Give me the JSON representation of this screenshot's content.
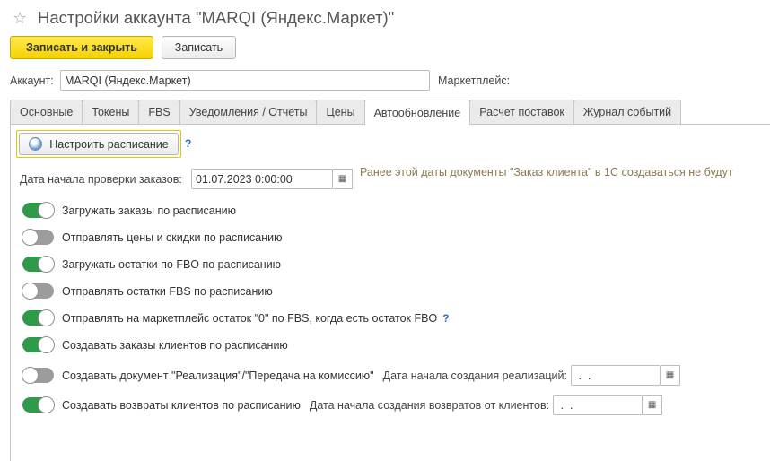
{
  "window": {
    "title": "Настройки аккаунта \"MARQI (Яндекс.Маркет)\"",
    "star_icon": "star-icon"
  },
  "toolbar": {
    "save_close_label": "Записать и закрыть",
    "save_label": "Записать"
  },
  "account": {
    "label": "Аккаунт:",
    "value": "MARQI (Яндекс.Маркет)",
    "marketplace_label": "Маркетплейс:"
  },
  "tabs": [
    {
      "label": "Основные"
    },
    {
      "label": "Токены"
    },
    {
      "label": "FBS"
    },
    {
      "label": "Уведомления / Отчеты"
    },
    {
      "label": "Цены"
    },
    {
      "label": "Автообновление",
      "active": true
    },
    {
      "label": "Расчет поставок"
    },
    {
      "label": "Журнал событий"
    }
  ],
  "schedule": {
    "button_label": "Настроить расписание",
    "help": "?"
  },
  "orders_check": {
    "label": "Дата начала проверки заказов:",
    "value": "01.07.2023  0:00:00",
    "note": "Ранее этой даты документы \"Заказ клиента\" в 1С создаваться не будут"
  },
  "toggles": [
    {
      "label": "Загружать заказы по расписанию",
      "on": true
    },
    {
      "label": "Отправлять цены и скидки по расписанию",
      "on": false
    },
    {
      "label": "Загружать остатки по FBO по расписанию",
      "on": true
    },
    {
      "label": "Отправлять остатки FBS по расписанию",
      "on": false
    },
    {
      "label": "Отправлять на маркетплейс остаток \"0\" по FBS, когда есть остаток FBO",
      "on": true,
      "help": "?"
    },
    {
      "label": "Создавать заказы клиентов по расписанию",
      "on": true
    },
    {
      "label": "Создавать документ \"Реализация\"/\"Передача на комиссию\"",
      "on": false,
      "date_label": "Дата начала создания реализаций:",
      "date_value": " .  ."
    },
    {
      "label": "Создавать возвраты клиентов по расписанию",
      "on": true,
      "date_label": "Дата начала создания возвратов от клиентов:",
      "date_value": " .  ."
    }
  ],
  "colors": {
    "toggle_on": "#2e9a4a",
    "toggle_off": "#9c9c9c",
    "primary_button": "#f5d200",
    "note_text": "#8a7a50"
  }
}
